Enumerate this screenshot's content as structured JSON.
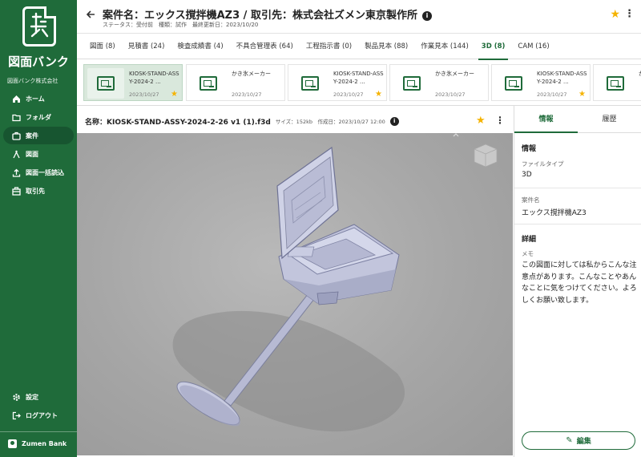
{
  "sidebar": {
    "logo_text": "図面バンク",
    "company": "図面バンク株式会社",
    "items": [
      {
        "label": "ホーム",
        "icon": "home-icon"
      },
      {
        "label": "フォルダ",
        "icon": "folder-icon"
      },
      {
        "label": "案件",
        "icon": "briefcase-icon"
      },
      {
        "label": "図面",
        "icon": "compass-icon"
      },
      {
        "label": "図面一括読込",
        "icon": "upload-icon"
      },
      {
        "label": "取引先",
        "icon": "building-icon"
      }
    ],
    "bottom_items": [
      {
        "label": "設定",
        "icon": "gear-icon"
      },
      {
        "label": "ログアウト",
        "icon": "logout-icon"
      }
    ],
    "user": "Zumen Bank"
  },
  "header": {
    "title": "案件名：エックス撹拌機AZ3 / 取引先：株式会社ズメン東京製作所",
    "meta": "ステータス：受付前　種類：試作　最終更新日：2023/10/20"
  },
  "tabs": [
    "図面 (8)",
    "見積書 (24)",
    "検査成績書 (4)",
    "不具合管理表 (64)",
    "工程指示書 (0)",
    "製品見本 (88)",
    "作業見本 (144)",
    "3D (8)",
    "CAM (16)"
  ],
  "active_tab": "3D (8)",
  "files": [
    {
      "name": "KIOSK-STAND-ASSY-2024-2 ...",
      "date": "2023/10/27",
      "starred": true
    },
    {
      "name": "かき氷メーカー",
      "date": "2023/10/27",
      "starred": false
    },
    {
      "name": "KIOSK-STAND-ASSY-2024-2 ...",
      "date": "2023/10/27",
      "starred": true
    },
    {
      "name": "かき氷メーカー",
      "date": "2023/10/27",
      "starred": false
    },
    {
      "name": "KIOSK-STAND-ASSY-2024-2 ...",
      "date": "2023/10/27",
      "starred": true
    },
    {
      "name": "か",
      "date": "",
      "starred": false
    }
  ],
  "file_header": {
    "name": "名称：KIOSK-STAND-ASSY-2024-2-26 v1 (1).f3d",
    "meta": "サイズ：152kb　作成日：2023/10/27 12:00"
  },
  "panel": {
    "tabs": [
      "情報",
      "履歴"
    ],
    "section1": "情報",
    "file_type_label": "ファイルタイプ",
    "file_type": "3D",
    "case_label": "案件名",
    "case_name": "エックス撹拌機AZ3",
    "section2": "詳細",
    "memo_label": "メモ",
    "memo": "この図面に対しては私からこんな注意点があります。こんなことやあんなことに気をつけてください。よろしくお願い致します。",
    "edit_label": "編集"
  },
  "colors": {
    "brand": "#1f6b3a",
    "star": "#f5b301",
    "selected_card": "#d9e8dc"
  }
}
